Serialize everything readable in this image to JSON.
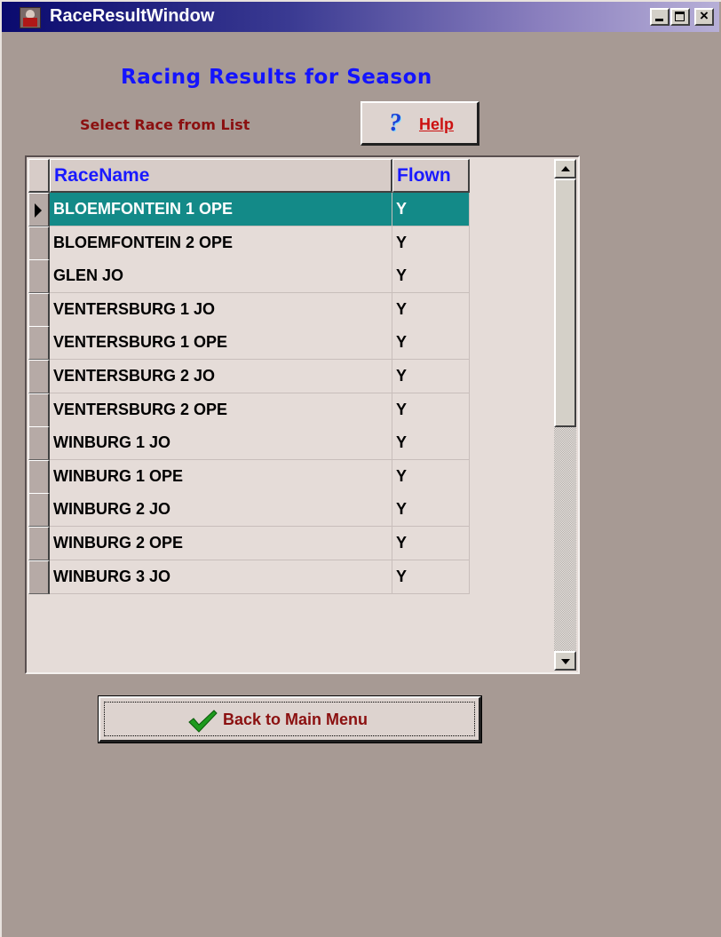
{
  "window": {
    "title": "RaceResultWindow",
    "controls": {
      "minimize": "_",
      "maximize": "□",
      "close": "×"
    }
  },
  "heading": "Racing Results for Season",
  "subheading": "Select Race from List",
  "help_button": {
    "label": "Help",
    "icon": "question-mark-icon"
  },
  "grid": {
    "columns": [
      "RaceName",
      "Flown"
    ],
    "selected_row": 0,
    "rows": [
      {
        "race_name": "BLOEMFONTEIN 1 OPE",
        "flown": "Y"
      },
      {
        "race_name": "BLOEMFONTEIN 2 OPE",
        "flown": "Y"
      },
      {
        "race_name": "GLEN JO",
        "flown": "Y"
      },
      {
        "race_name": "VENTERSBURG 1 JO",
        "flown": "Y"
      },
      {
        "race_name": "VENTERSBURG 1 OPE",
        "flown": "Y"
      },
      {
        "race_name": "VENTERSBURG 2 JO",
        "flown": "Y"
      },
      {
        "race_name": "VENTERSBURG 2 OPE",
        "flown": "Y"
      },
      {
        "race_name": "WINBURG 1 JO",
        "flown": "Y"
      },
      {
        "race_name": "WINBURG 1 OPE",
        "flown": "Y"
      },
      {
        "race_name": "WINBURG 2 JO",
        "flown": "Y"
      },
      {
        "race_name": "WINBURG 2 OPE",
        "flown": "Y"
      },
      {
        "race_name": "WINBURG 3 JO",
        "flown": "Y"
      }
    ]
  },
  "back_button": {
    "label": "Back to Main Menu",
    "icon": "checkmark-icon"
  },
  "colors": {
    "background": "#a79a94",
    "heading": "#1414ff",
    "subheading": "#8b1010",
    "selection": "#138a88"
  }
}
